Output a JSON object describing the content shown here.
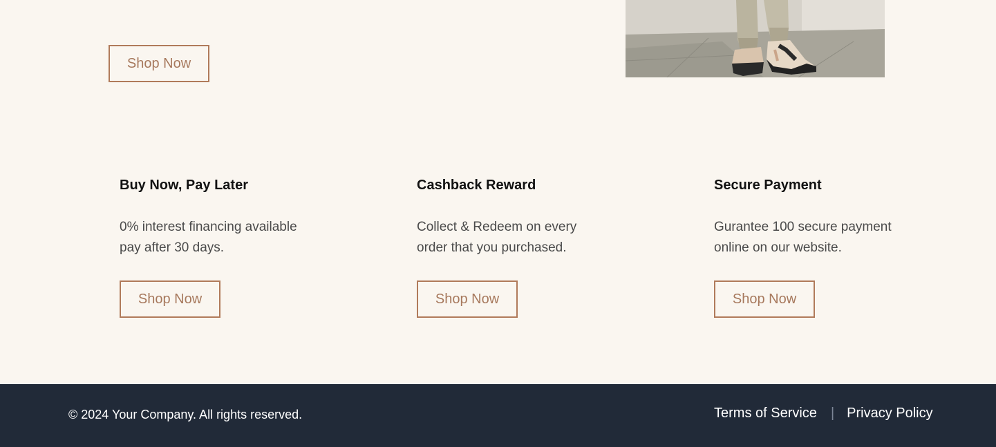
{
  "hero": {
    "shop_label": "Shop Now",
    "image_alt": "Person wearing beige pants and black-and-cream sneakers"
  },
  "features": [
    {
      "title": "Buy Now, Pay Later",
      "desc_line1": "0% interest financing available",
      "desc_line2": "pay after 30 days.",
      "button_label": "Shop Now"
    },
    {
      "title": "Cashback Reward",
      "desc_line1": "Collect & Redeem on every",
      "desc_line2": "order that you purchased.",
      "button_label": "Shop Now"
    },
    {
      "title": "Secure Payment",
      "desc_line1": "Gurantee 100 secure payment",
      "desc_line2": "online on our website.",
      "button_label": "Shop Now"
    }
  ],
  "footer": {
    "copyright": "© 2024 Your Company. All rights reserved.",
    "terms_label": "Terms of Service",
    "separator": "|",
    "privacy_label": "Privacy Policy"
  },
  "colors": {
    "page_bg": "#faf6f0",
    "accent": "#b07a5a",
    "footer_bg": "#212a38"
  }
}
